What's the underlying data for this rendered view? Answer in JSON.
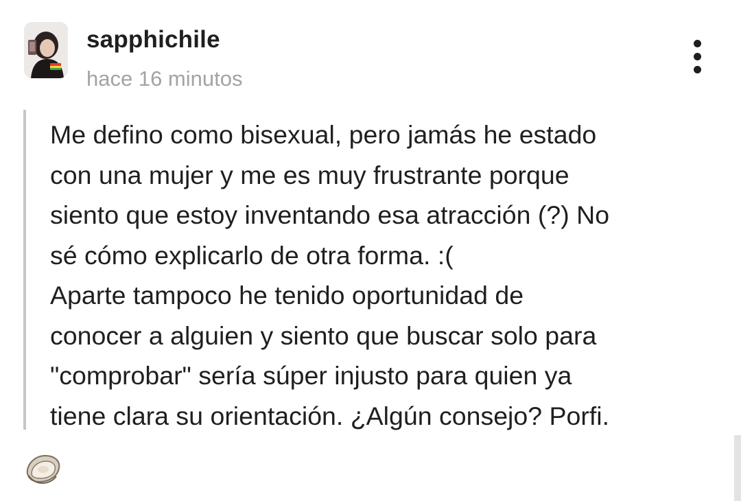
{
  "post": {
    "username": "sapphichile",
    "timestamp": "hace 16 minutos",
    "body_lines": [
      "Me defino como bisexual, pero jamás he estado",
      "con una mujer y me es muy frustrante porque",
      "siento que estoy inventando esa atracción (?) No",
      "sé cómo explicarlo de otra forma. :(",
      "Aparte tampoco he tenido oportunidad de",
      "conocer a alguien y siento que buscar solo para",
      "\"comprobar\" sería súper injusto para quien ya",
      "tiene clara su orientación. ¿Algún consejo? Porfi."
    ]
  },
  "icons": {
    "more": "vertical-ellipsis-icon",
    "reaction": "oyster-icon",
    "avatar": "profile-photo"
  },
  "colors": {
    "text": "#1f1f1f",
    "muted": "#a3a3a3",
    "quote_bar": "#c6c6c6",
    "background": "#ffffff"
  }
}
